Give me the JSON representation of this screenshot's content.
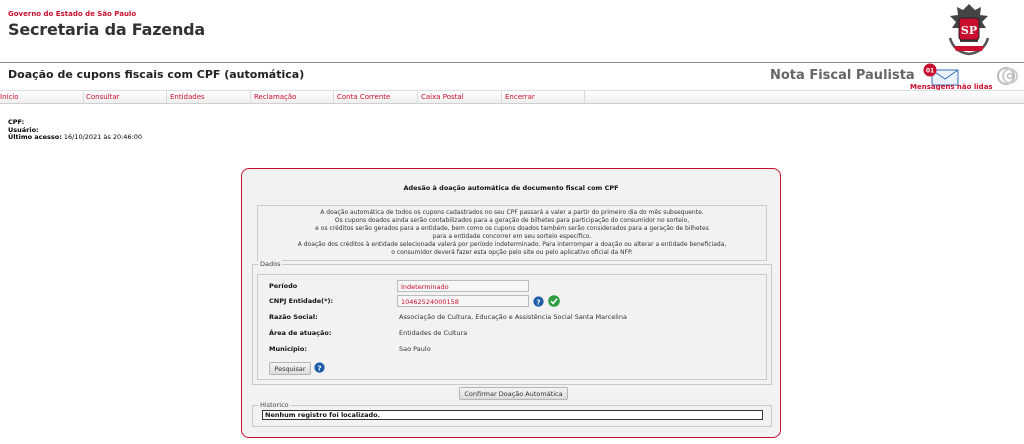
{
  "header": {
    "gov_line": "Governo do Estado de São Paulo",
    "secretaria": "Secretaria da Fazenda",
    "crest_text": "SP"
  },
  "title_bar": {
    "page_title": "Doação de cupons fiscais com CPF (automática)",
    "app_name": "Nota Fiscal Paulista",
    "messages_count": "01",
    "messages_label": "Mensagens não lidas"
  },
  "menu": {
    "items": [
      "Início",
      "Consultar",
      "Entidades",
      "Reclamação",
      "Conta Corrente",
      "Caixa Postal",
      "Encerrar"
    ]
  },
  "user": {
    "cpf_label": "CPF:",
    "cpf_value": "",
    "usuario_label": "Usuário:",
    "usuario_value": "",
    "ultimo_acesso_label": "Último acesso:",
    "ultimo_acesso_value": "16/10/2021 às 20:46:00"
  },
  "panel": {
    "title": "Adesão à doação automática de documento fiscal com CPF",
    "info_lines": [
      "A doação automática de todos os cupons cadastrados no seu CPF passará a valer a partir do primeiro dia do mês subsequente.",
      "Os cupons doados ainda serão contabilizados para a geração de bilhetes para participação do consumidor no sorteio,",
      "e os créditos serão gerados para a entidade, bem como os cupons doados também serão considerados para a geração de bilhetes",
      "para a entidade concorrer em seu sorteio específico.",
      "A doação dos créditos à entidade selecionada valerá por período indeterminado. Para interromper a doação ou alterar a entidade beneficiada,",
      "o consumidor deverá fazer esta opção pelo site ou pelo aplicativo oficial da NFP."
    ],
    "dados_legend": "Dados",
    "periodo_label": "Período",
    "periodo_value": "Indeterminado",
    "cnpj_label": "CNPJ Entidade(*):",
    "cnpj_value": "10462524000158",
    "razao_label": "Razão Social:",
    "razao_value": "Associação de Cultura, Educação e Assistência Social Santa Marcelina",
    "area_label": "Área de atuação:",
    "area_value": "Entidades de Cultura",
    "municipio_label": "Município:",
    "municipio_value": "Sao Paulo",
    "pesquisar_label": "Pesquisar",
    "confirm_label": "Confirmar Doação Automática",
    "historico_legend": "Historico",
    "historico_empty": "Nenhum registro foi localizado."
  },
  "colors": {
    "accent": "#c8102e",
    "panel_bg": "#f2f2f2",
    "help_blue": "#1e5ca8",
    "check_green": "#2e9e3e"
  },
  "icons": {
    "crest": "sp-crest-icon",
    "messages": "envelope-icon",
    "at": "at-sign-icon",
    "help": "help-icon",
    "check": "check-icon"
  }
}
